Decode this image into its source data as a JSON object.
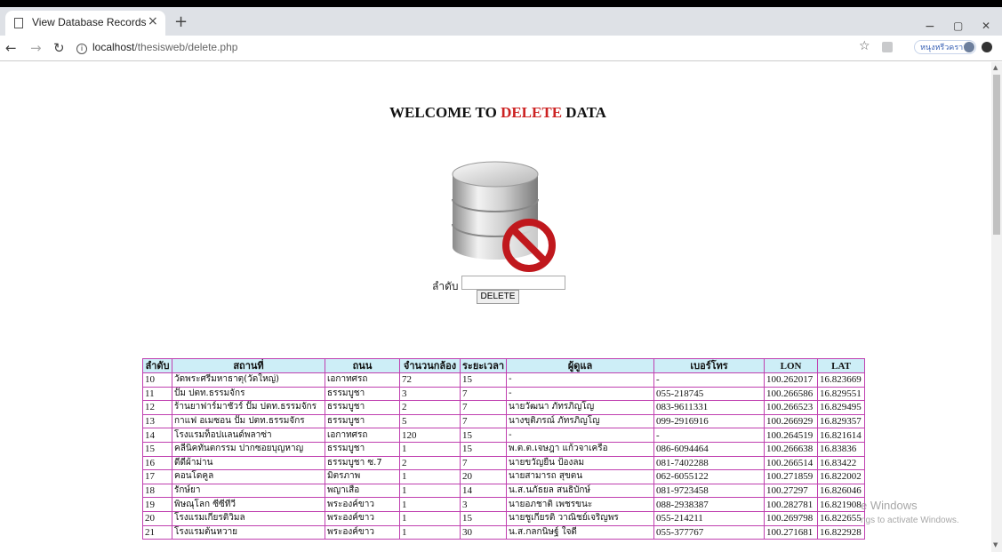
{
  "browser": {
    "tab_title": "View Database Records",
    "tab_close": "×",
    "new_tab": "+",
    "url_host": "localhost",
    "url_path": "/thesisweb/delete.php",
    "profile_label": "หนุงหรีวคราว",
    "win_min": "−",
    "win_max": "▢",
    "win_close": "✕"
  },
  "page": {
    "heading_prefix": "WELCOME TO ",
    "heading_red": "DELETE",
    "heading_suffix": " DATA",
    "form_label": "ลำดับ :",
    "input_value": "",
    "delete_button": "DELETE"
  },
  "table": {
    "headers": [
      "ลำดับ",
      "สถานที่",
      "ถนน",
      "จำนวนกล้อง",
      "ระยะเวลา",
      "ผู้ดูแล",
      "เบอร์โทร",
      "LON",
      "LAT"
    ],
    "rows": [
      [
        "10",
        "วัดพระศรีมหาธาตุ(วัดใหญ่)",
        "เอกาทศรถ",
        "72",
        "15",
        "-",
        "-",
        "100.262017",
        "16.823669"
      ],
      [
        "11",
        "ปั๊ม ปตท.ธรรมจักร",
        "ธรรมบูชา",
        "3",
        "7",
        "-",
        "055-218745",
        "100.266586",
        "16.829551"
      ],
      [
        "12",
        "ร้านยาฟาร์มาชัวร์ ปั๊ม ปตท.ธรรมจักร",
        "ธรรมบูชา",
        "2",
        "7",
        "นายวัฒนา ภัทรภิญโญ",
        "083-9611331",
        "100.266523",
        "16.829495"
      ],
      [
        "13",
        "กาแฟ อเมซอน ปั๊ม ปตท.ธรรมจักร",
        "ธรรมบูชา",
        "5",
        "7",
        "นางขุติภรณ์ ภัทรภิญโญ",
        "099-2916916",
        "100.266929",
        "16.829357"
      ],
      [
        "14",
        "โรงแรมท็อปแลนด์พลาซ่า",
        "เอกาทศรถ",
        "120",
        "15",
        "-",
        "-",
        "100.264519",
        "16.821614"
      ],
      [
        "15",
        "คลีนิคทันตกรรม ปากซอยบุญหาญ",
        "ธรรมบูชา",
        "1",
        "15",
        "พ.ต.ต.เจษฎา แก้วจาเครือ",
        "086-6094464",
        "100.266638",
        "16.83836"
      ],
      [
        "16",
        "ดีดีผ้าม่าน",
        "ธรรมบูชา ซ.7",
        "2",
        "7",
        "นายขวัญยืน ป้องลม",
        "081-7402288",
        "100.266514",
        "16.83422"
      ],
      [
        "17",
        "คอนโดคูล",
        "มิตรภาพ",
        "1",
        "20",
        "นายสามารถ สุขตน",
        "062-6055122",
        "100.271859",
        "16.822002"
      ],
      [
        "18",
        "รักษ์ยา",
        "พญาเสือ",
        "1",
        "14",
        "น.ส.นภัธยล สนธิบักษ์",
        "081-9723458",
        "100.27297",
        "16.826046"
      ],
      [
        "19",
        "พิษณุโลก ซีซีทีวี",
        "พระองค์ขาว",
        "1",
        "3",
        "นายอภชาติ เพชรขนะ",
        "088-2938387",
        "100.282781",
        "16.821908"
      ],
      [
        "20",
        "โรงแรมเกียรติวิมล",
        "พระองค์ขาว",
        "1",
        "15",
        "นายชูเกียรติ วาณิชย์เจริญพร",
        "055-214211",
        "100.269798",
        "16.822655"
      ],
      [
        "21",
        "โรงแรมต้นหวาย",
        "พระองค์ขาว",
        "1",
        "30",
        "น.ส.กลกนิษฐ์ ใจดี",
        "055-377767",
        "100.271681",
        "16.822928"
      ]
    ]
  },
  "watermark": {
    "line1": "e Windows",
    "line2": "ngs to activate Windows."
  }
}
